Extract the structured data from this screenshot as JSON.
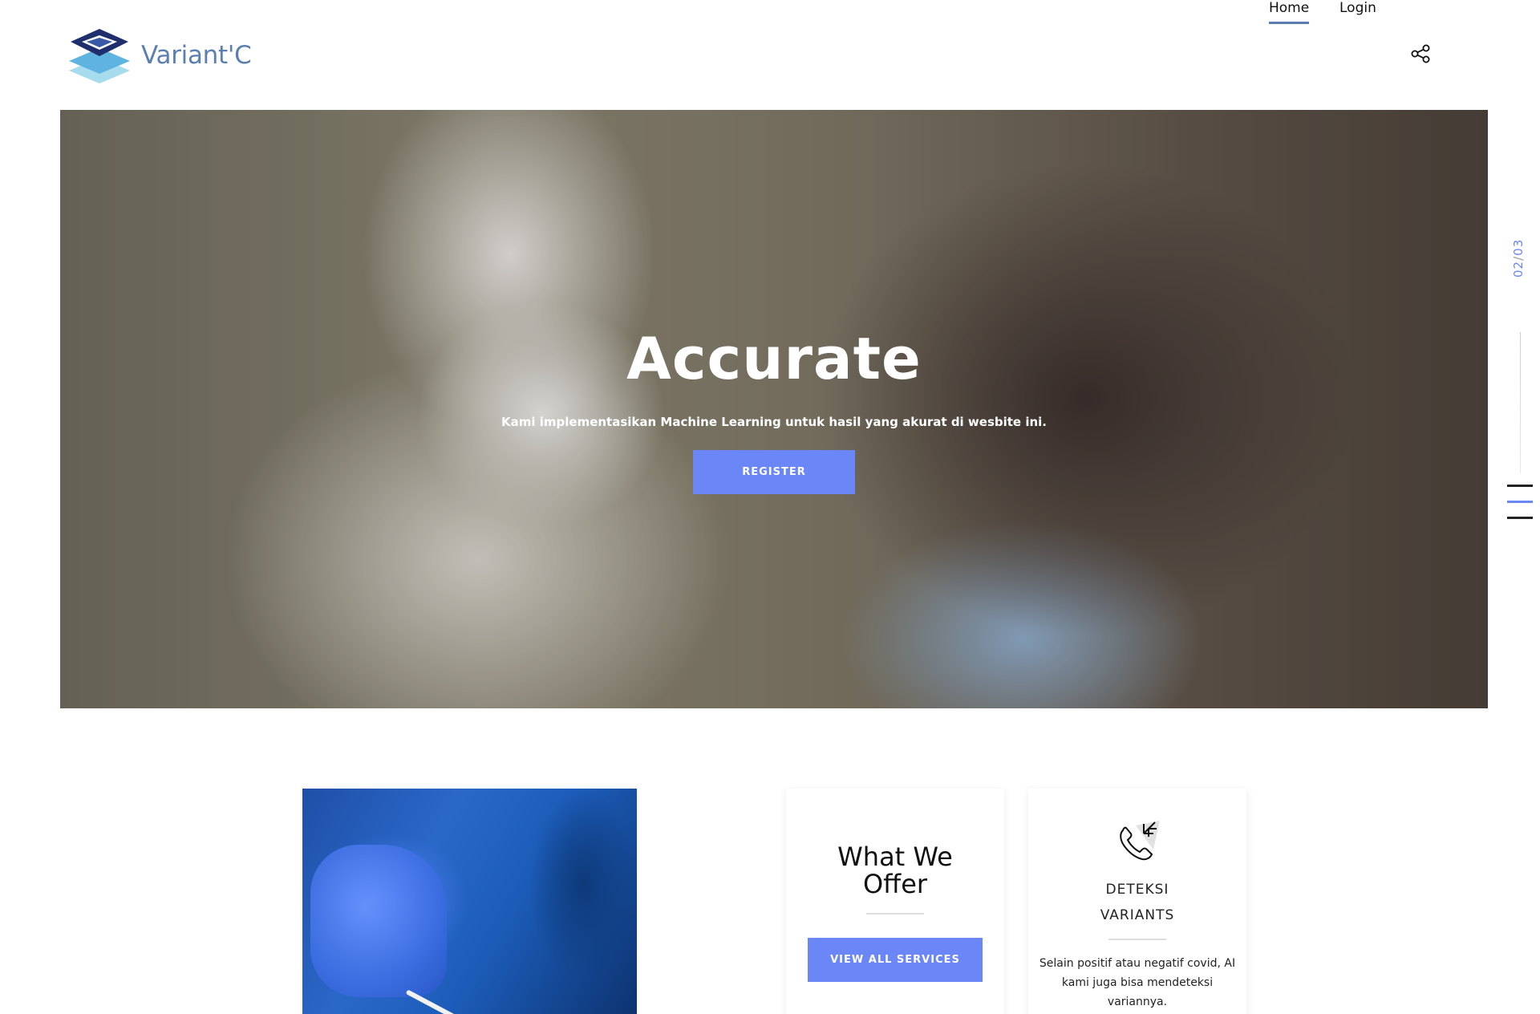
{
  "brand": {
    "name": "Variant'C"
  },
  "nav": {
    "items": [
      {
        "label": "Home",
        "active": true
      },
      {
        "label": "Login",
        "active": false
      }
    ],
    "share_icon": "share-icon"
  },
  "hero": {
    "title": "Accurate",
    "subtitle": "Kami implementasikan Machine Learning untuk hasil yang akurat di wesbite ini.",
    "button_label": "REGISTER",
    "slide_current": "02",
    "slide_separator": "/",
    "slide_total": "03"
  },
  "offer_card": {
    "title_line1": "What We",
    "title_line2": "Offer",
    "button_label": "VIEW ALL SERVICES"
  },
  "deteksi_card": {
    "icon": "phone-icon",
    "title_line1": "DETEKSI",
    "title_line2": "VARIANTS",
    "text": "Selain positif atau negatif covid, AI kami juga bisa mendeteksi variannya."
  },
  "colors": {
    "accent": "#6b86f7",
    "brand_blue": "#5b7fb0"
  }
}
